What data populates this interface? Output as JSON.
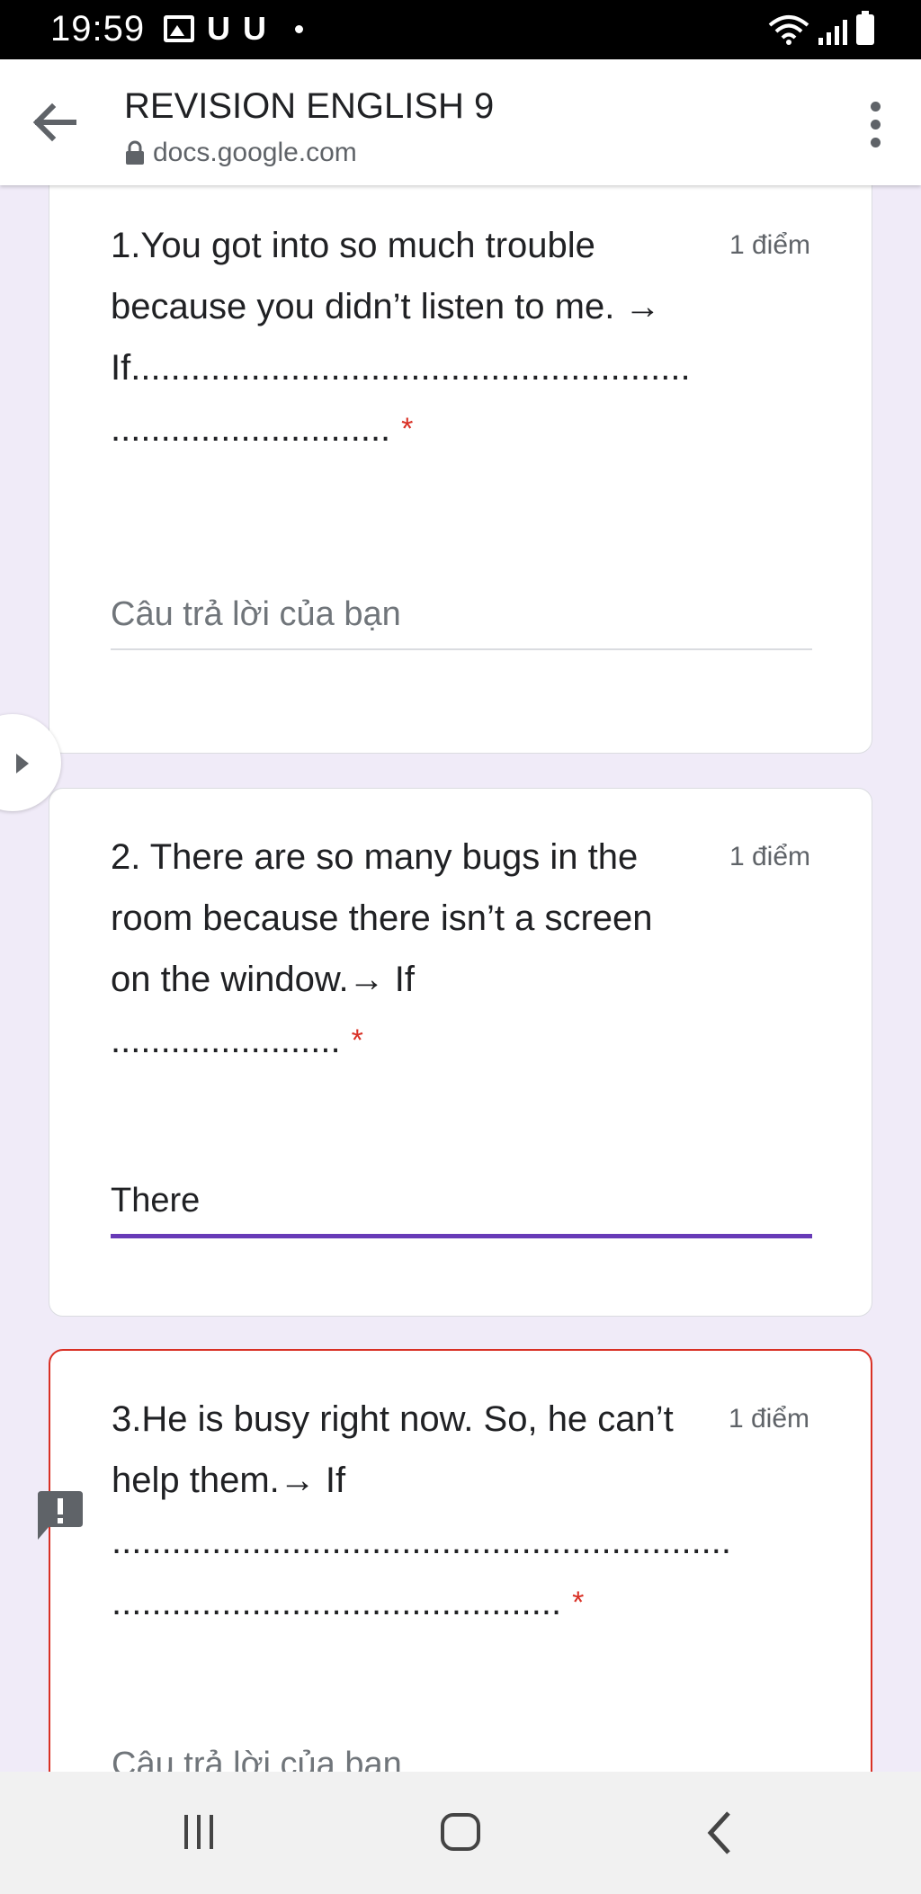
{
  "status_bar": {
    "time": "19:59",
    "icons": [
      "gallery-icon",
      "u-icon",
      "u-icon",
      "dot",
      "wifi-icon",
      "signal-icon",
      "battery-icon"
    ],
    "u_glyph": "U"
  },
  "app_bar": {
    "title": "REVISION ENGLISH 9",
    "url": "docs.google.com"
  },
  "questions": [
    {
      "text": "1.You got into so much trouble because you didn’t listen to me. →\nIf........................................................\n............................",
      "points": "1 điểm",
      "required_mark": "*",
      "answer_value": "",
      "answer_placeholder": "Câu trả lời của bạn"
    },
    {
      "text": "2. There are so many bugs in the room because there isn’t a screen on the window.→ If\n.......................",
      "points": "1 điểm",
      "required_mark": "*",
      "answer_value": "There",
      "answer_placeholder": ""
    },
    {
      "text": "3.He is busy right now. So, he can’t help them.→ If\n..............................................................\n.............................................",
      "points": "1 điểm",
      "required_mark": "*",
      "answer_value": "",
      "answer_placeholder": "Câu trả lời của bạn"
    }
  ],
  "colors": {
    "page_background": "#f0ebf8",
    "accent": "#673ab7",
    "error": "#d93025"
  }
}
